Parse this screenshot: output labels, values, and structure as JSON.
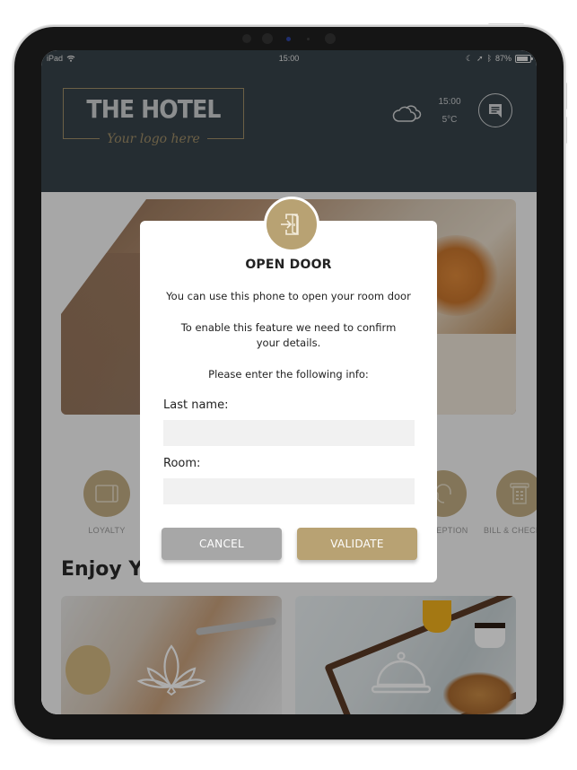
{
  "device": {
    "status_bar": {
      "carrier": "iPad",
      "time": "15:00",
      "battery": "87%",
      "battery_level": 0.87,
      "icons": [
        "wifi-icon",
        "moon-icon",
        "location-icon",
        "bluetooth-icon",
        "battery-icon"
      ]
    }
  },
  "header": {
    "logo_title": "THE HOTEL",
    "logo_tagline": "Your logo here",
    "weather": {
      "icon": "cloud-icon",
      "time": "15:00",
      "temperature": "5°C"
    },
    "chat_icon": "chat-icon"
  },
  "services": [
    {
      "label": "LOYALTY",
      "icon": "card-icon"
    },
    {
      "label": "RECEPTION",
      "icon": "headset-icon"
    },
    {
      "label": "BILL & CHECKOUT",
      "icon": "bill-icon"
    }
  ],
  "section": {
    "title": "Enjoy Your Stay"
  },
  "cards": [
    {
      "name": "spa",
      "icon": "lotus-icon"
    },
    {
      "name": "room-service",
      "icon": "cloche-icon"
    }
  ],
  "modal": {
    "icon": "door-enter-icon",
    "title": "OPEN DOOR",
    "text1": "You can use this phone to open your room door",
    "text2": "To enable this feature we need to confirm your details.",
    "text3": "Please enter the following info:",
    "last_name_label": "Last name:",
    "last_name_value": "",
    "room_label": "Room:",
    "room_value": "",
    "cancel_label": "CANCEL",
    "validate_label": "VALIDATE"
  },
  "colors": {
    "header_bg": "#37434a",
    "accent_gold": "#b8a273",
    "cancel_gray": "#a7a7a7"
  }
}
